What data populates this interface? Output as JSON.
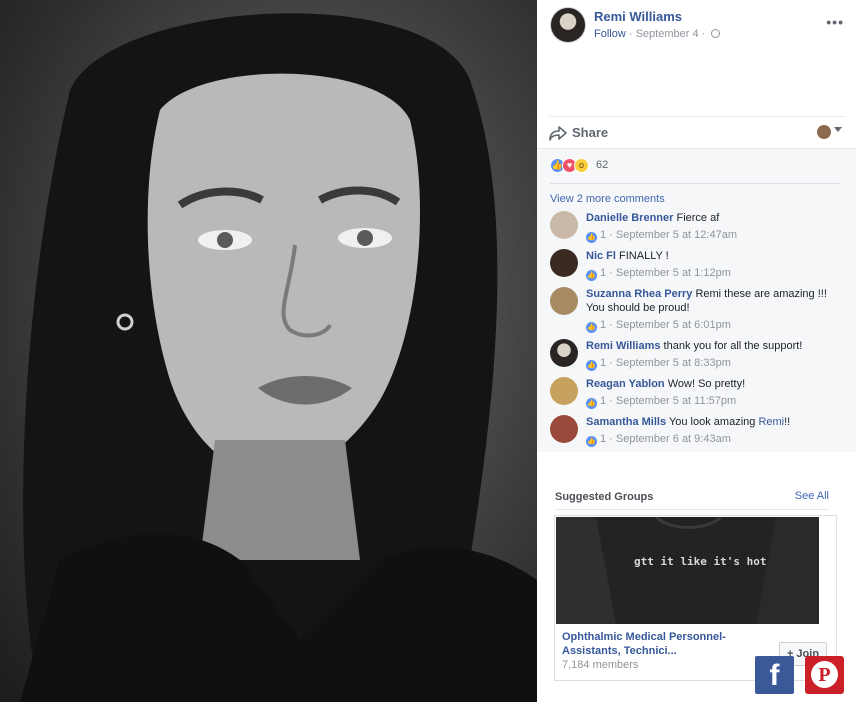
{
  "photo": {
    "alt_icon": "portrait-photo"
  },
  "post": {
    "author": "Remi Williams",
    "follow_label": "Follow",
    "date": "September 4",
    "separator": "·",
    "more_icon": "more-dots-icon"
  },
  "actions": {
    "share_label": "Share"
  },
  "reactions": {
    "count": "62",
    "icons": [
      "like-icon",
      "love-icon",
      "wow-icon"
    ]
  },
  "comments": {
    "view_more": "View 2 more comments",
    "items": [
      {
        "name": "Danielle Brenner",
        "text": "Fierce af",
        "likes": "1",
        "time": "September 5 at 12:47am"
      },
      {
        "name": "Nic Fl",
        "text": "FINALLY !",
        "likes": "1",
        "time": "September 5 at 1:12pm"
      },
      {
        "name": "Suzanna Rhea Perry",
        "text": "Remi these are amazing !!! You should be proud!",
        "likes": "1",
        "time": "September 5 at 6:01pm"
      },
      {
        "name": "Remi Williams",
        "text": "thank you for all the support!",
        "likes": "1",
        "time": "September 5 at 8:33pm"
      },
      {
        "name": "Reagan Yablon",
        "text": "Wow! So pretty!",
        "likes": "1",
        "time": "September 5 at 11:57pm"
      },
      {
        "name": "Samantha Mills",
        "text": "You look amazing",
        "mention": "Remi",
        "text_after": "!!",
        "likes": "1",
        "time": "September 6 at 9:43am"
      }
    ]
  },
  "groups": {
    "title": "Suggested Groups",
    "see_all": "See All",
    "card": {
      "image_text": "gtt it like it's hot",
      "name": "Ophthalmic Medical Personnel-Assistants, Technici...",
      "members": "7,184 members",
      "join_label": "+ Join"
    }
  },
  "social": {
    "facebook_glyph": "f",
    "pinterest_glyph": "P"
  },
  "colors": {
    "link": "#365899",
    "facebook": "#3b5998",
    "pinterest": "#cb2027",
    "muted": "#90949c"
  }
}
